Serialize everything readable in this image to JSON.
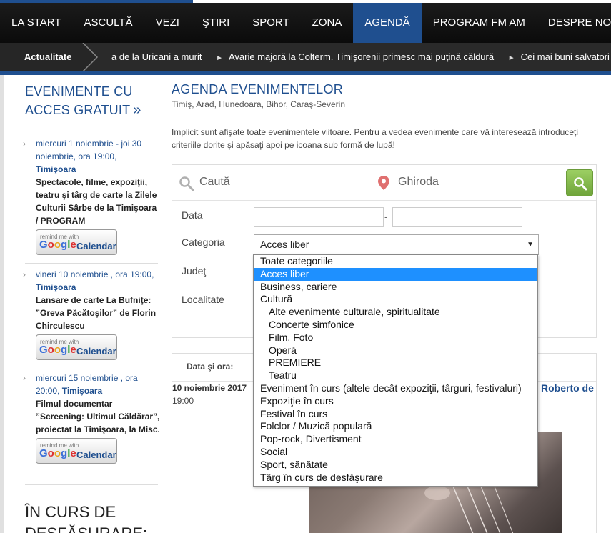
{
  "nav": {
    "items": [
      "LA START",
      "ASCULTĂ",
      "VEZI",
      "ŞTIRI",
      "SPORT",
      "ZONA",
      "AGENDĂ",
      "PROGRAM FM AM",
      "DESPRE NOI"
    ],
    "active_index": 6
  },
  "ticker": {
    "label": "Actualitate",
    "items": [
      "a de la Uricani a murit",
      "Avarie majoră la Colterm. Timişorenii primesc mai puţină căldură",
      "Cei mai buni salvatori minieri din"
    ]
  },
  "sidebar": {
    "title": "EVENIMENTE CU ACCES GRATUIT",
    "title_arrow": "»",
    "events": [
      {
        "date": "miercuri 1 noiembrie - joi 30 noiembrie, ora 19:00,",
        "city": "Timişoara",
        "title": "Spectacole, filme, expoziţii, teatru şi târg de carte la Zilele Culturii Sârbe de la Timişoara / PROGRAM"
      },
      {
        "date": "vineri 10 noiembrie , ora 19:00,",
        "city": "Timişoara",
        "title": "Lansare de carte La Bufniţe: ”Greva Păcătoşilor” de Florin Chirculescu"
      },
      {
        "date": "miercuri 15 noiembrie , ora 20:00,",
        "city": "Timişoara",
        "title": "Filmul documentar ”Screening: Ultimul Căldărar”, proiectat la Timişoara, la Misc."
      }
    ],
    "gcal": {
      "remind": "remind me with",
      "google": "Google",
      "calendar": "Calendar"
    },
    "in_progress_title": "ÎN CURS DE DESFĂŞURARE:"
  },
  "main": {
    "title": "AGENDA EVENIMENTELOR",
    "regions": "Timiş, Arad, Hunedoara, Bihor, Caraş-Severin",
    "info": "Implicit sunt afişate toate evenimentele viitoare. Pentru a vedea evenimente care vă interesează introduceţi criteriile dorite şi apăsaţi apoi pe icoana sub formă de lupă!",
    "search": {
      "placeholder": "Caută",
      "location": "Ghiroda"
    },
    "filters": {
      "date_label": "Data",
      "date_separator": "-",
      "category_label": "Categoria",
      "category_value": "Acces liber",
      "county_label": "Judeţ",
      "locality_label": "Localitate"
    },
    "results": {
      "header_date": "Data şi ora:",
      "first_date": "10 noiembrie 2017",
      "first_time": "19:00",
      "first_title_partial": "Roberto de"
    }
  },
  "dropdown": {
    "selected_index": 1,
    "options": [
      {
        "label": "Toate categoriile",
        "indent": false
      },
      {
        "label": "Acces liber",
        "indent": false
      },
      {
        "label": "Business, cariere",
        "indent": false
      },
      {
        "label": "Cultură",
        "indent": false
      },
      {
        "label": "Alte evenimente culturale, spiritualitate",
        "indent": true
      },
      {
        "label": "Concerte simfonice",
        "indent": true
      },
      {
        "label": "Film, Foto",
        "indent": true
      },
      {
        "label": "Operă",
        "indent": true
      },
      {
        "label": "PREMIERE",
        "indent": true
      },
      {
        "label": "Teatru",
        "indent": true
      },
      {
        "label": "Eveniment în curs (altele decât expoziţii, târguri, festivaluri)",
        "indent": false
      },
      {
        "label": "Expoziţie în curs",
        "indent": false
      },
      {
        "label": "Festival în curs",
        "indent": false
      },
      {
        "label": "Folclor / Muzică populară",
        "indent": false
      },
      {
        "label": "Pop-rock, Divertisment",
        "indent": false
      },
      {
        "label": "Social",
        "indent": false
      },
      {
        "label": "Sport, sănătate",
        "indent": false
      },
      {
        "label": "Târg în curs de desfăşurare",
        "indent": false
      }
    ]
  },
  "colors": {
    "brand_blue": "#1f4f8f",
    "nav_bg": "#111111",
    "selected_option": "#1e90ff",
    "search_button": "#8cc152"
  }
}
